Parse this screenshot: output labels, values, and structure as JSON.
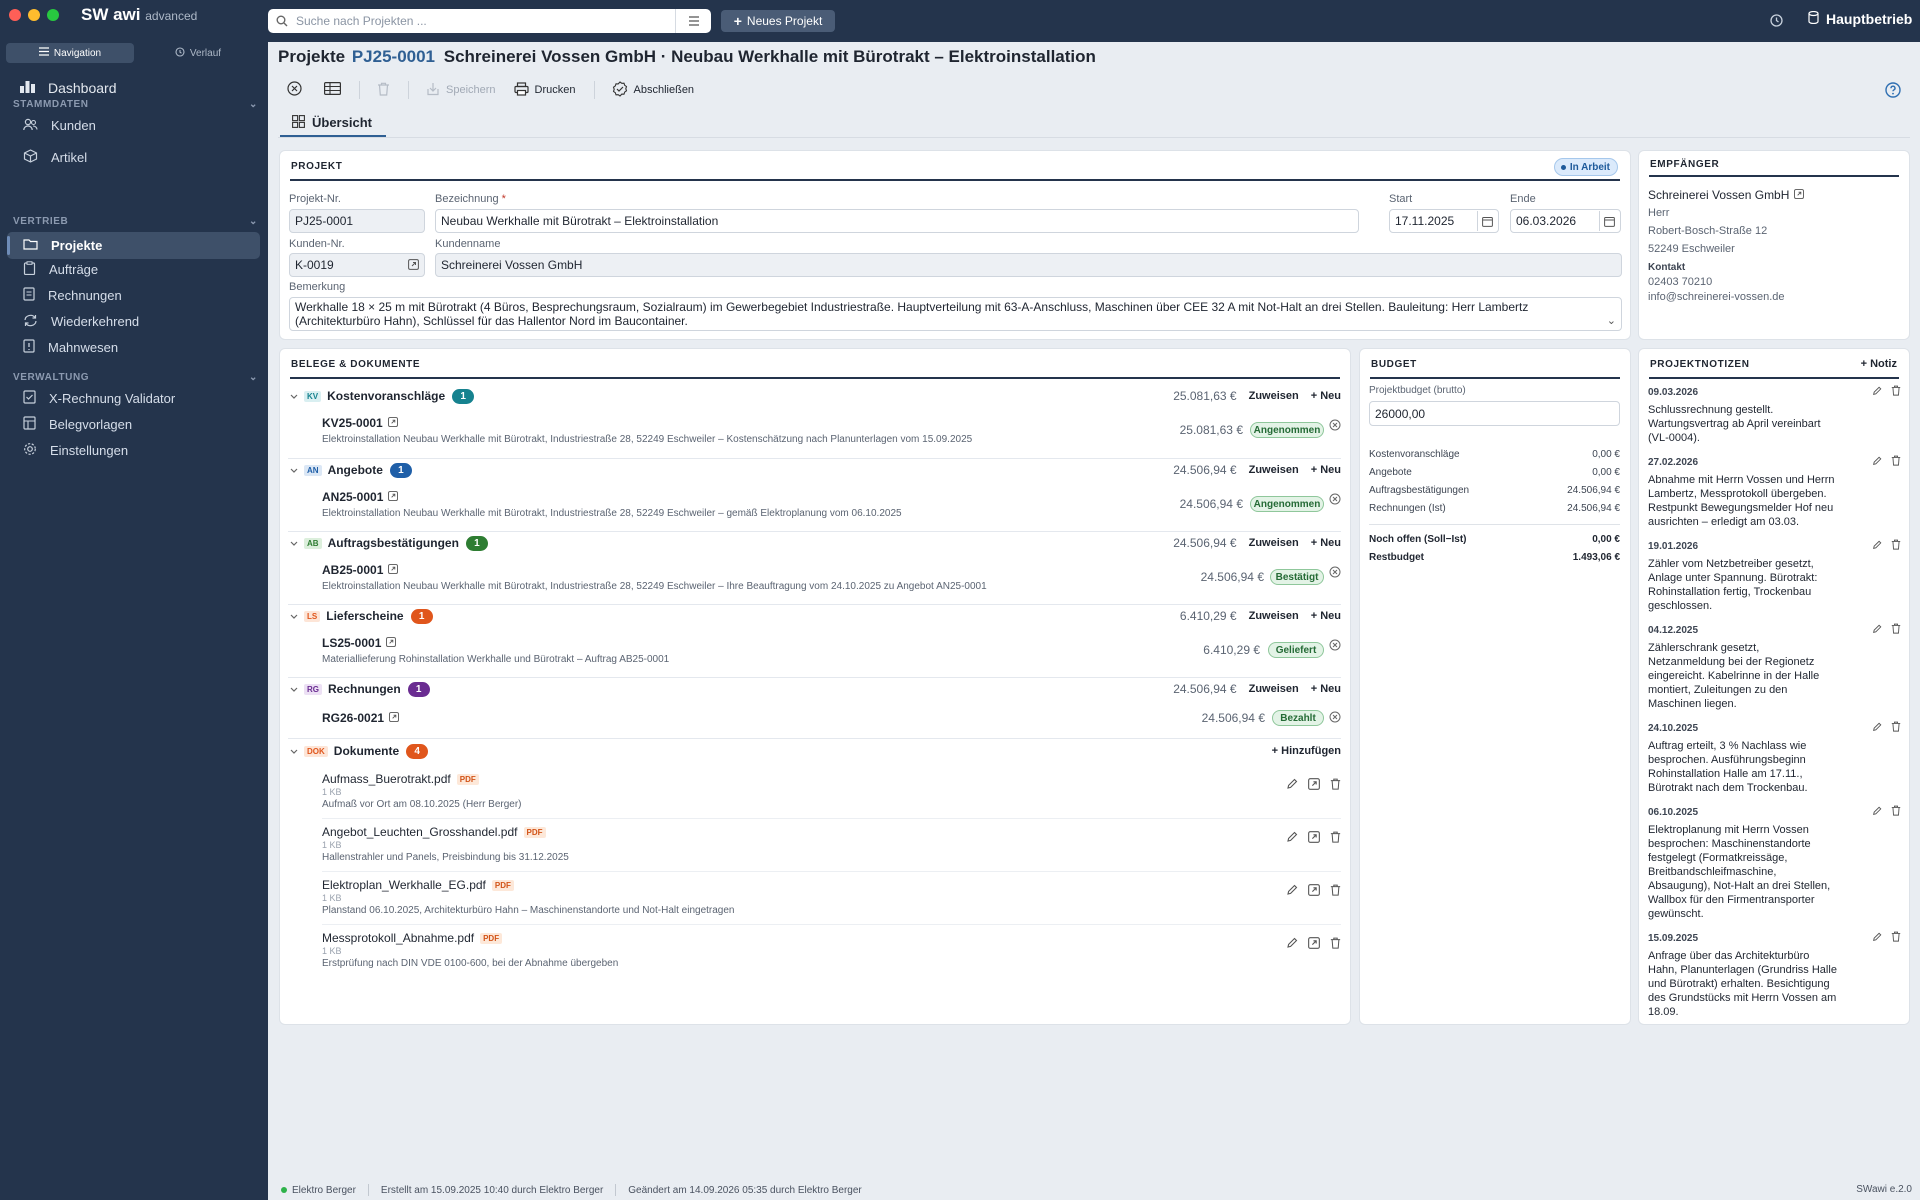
{
  "app": {
    "brand": "SW awi",
    "edition": "advanced",
    "search_placeholder": "Suche nach Projekten ...",
    "new_project": "Neues Projekt",
    "company": "Hauptbetrieb",
    "colors": {
      "navy": "#24344c",
      "accent": "#2f5f93"
    }
  },
  "sidebar": {
    "tab_nav": "Navigation",
    "tab_history": "Verlauf",
    "dashboard": "Dashboard",
    "sections": [
      {
        "title": "STAMMDATEN",
        "items": [
          {
            "label": "Kunden",
            "icon": "users-icon"
          },
          {
            "label": "Artikel",
            "icon": "box-icon"
          }
        ]
      },
      {
        "title": "VERTRIEB",
        "items": [
          {
            "label": "Projekte",
            "icon": "folder-icon",
            "active": true
          },
          {
            "label": "Aufträge",
            "icon": "clipboard-icon"
          },
          {
            "label": "Rechnungen",
            "icon": "invoice-icon"
          },
          {
            "label": "Wiederkehrend",
            "icon": "repeat-icon"
          },
          {
            "label": "Mahnwesen",
            "icon": "reminder-icon"
          }
        ]
      },
      {
        "title": "VERWALTUNG",
        "items": [
          {
            "label": "X-Rechnung Validator",
            "icon": "checklist-icon"
          },
          {
            "label": "Belegvorlagen",
            "icon": "template-icon"
          },
          {
            "label": "Einstellungen",
            "icon": "gear-icon"
          }
        ]
      }
    ]
  },
  "page": {
    "prefix": "Projekte",
    "number": "PJ25-0001",
    "title": "Schreinerei Vossen GmbH · Neubau Werkhalle mit Bürotrakt – Elektroinstallation"
  },
  "toolbar": {
    "save": "Speichern",
    "print": "Drucken",
    "close": "Abschließen"
  },
  "tabs": {
    "overview": "Übersicht"
  },
  "project": {
    "heading": "PROJEKT",
    "status": "In Arbeit",
    "nr_label": "Projekt-Nr.",
    "nr": "PJ25-0001",
    "name_label": "Bezeichnung",
    "name": "Neubau Werkhalle mit Bürotrakt – Elektroinstallation",
    "start_label": "Start",
    "start": "17.11.2025",
    "end_label": "Ende",
    "end": "06.03.2026",
    "cust_nr_label": "Kunden-Nr.",
    "cust_nr": "K-0019",
    "cust_name_label": "Kundenname",
    "cust_name": "Schreinerei Vossen GmbH",
    "remark_label": "Bemerkung",
    "remark_1": "Werkhalle 18 × 25 m mit Bürotrakt (4 Büros, Besprechungsraum, Sozialraum) im Gewerbegebiet Industriestraße. Hauptverteilung mit 63-A-Anschluss, Maschinen über CEE 32 A mit Not-Halt an drei Stellen. Bauleitung: Herr Lambertz",
    "remark_2": "(Architekturbüro Hahn), Schlüssel für das Hallentor Nord im Baucontainer."
  },
  "recipient": {
    "heading": "EMPFÄNGER",
    "name": "Schreinerei Vossen GmbH",
    "salutation": "Herr",
    "street": "Robert-Bosch-Straße 12",
    "city": "52249 Eschweiler",
    "contact_label": "Kontakt",
    "phone": "02403 70210",
    "email": "info@schreinerei-vossen.de"
  },
  "docs": {
    "heading": "BELEGE & DOKUMENTE",
    "assign": "Zuweisen",
    "new": "+ Neu",
    "groups": [
      {
        "tag": "KV",
        "name": "Kostenvoranschläge",
        "count": "1",
        "sum": "25.081,63 €",
        "color": "#16828f",
        "doc": {
          "no": "KV25-0001",
          "desc": "Elektroinstallation Neubau Werkhalle mit Bürotrakt, Industriestraße 28, 52249 Eschweiler – Kostenschätzung nach Planunterlagen vom 15.09.2025",
          "amount": "25.081,63 €",
          "status": "Angenommen"
        }
      },
      {
        "tag": "AN",
        "name": "Angebote",
        "count": "1",
        "sum": "24.506,94 €",
        "color": "#1f5fa8",
        "doc": {
          "no": "AN25-0001",
          "desc": "Elektroinstallation Neubau Werkhalle mit Bürotrakt, Industriestraße 28, 52249 Eschweiler – gemäß Elektroplanung vom 06.10.2025",
          "amount": "24.506,94 €",
          "status": "Angenommen"
        }
      },
      {
        "tag": "AB",
        "name": "Auftragsbestätigungen",
        "count": "1",
        "sum": "24.506,94 €",
        "color": "#2e7d32",
        "doc": {
          "no": "AB25-0001",
          "desc": "Elektroinstallation Neubau Werkhalle mit Bürotrakt, Industriestraße 28, 52249 Eschweiler – Ihre Beauftragung vom 24.10.2025 zu Angebot AN25-0001",
          "amount": "24.506,94 €",
          "status": "Bestätigt"
        }
      },
      {
        "tag": "LS",
        "name": "Lieferscheine",
        "count": "1",
        "sum": "6.410,29 €",
        "color": "#e0561c",
        "doc": {
          "no": "LS25-0001",
          "desc": "Materiallieferung Rohinstallation Werkhalle und Bürotrakt – Auftrag AB25-0001",
          "amount": "6.410,29 €",
          "status": "Geliefert"
        }
      },
      {
        "tag": "RG",
        "name": "Rechnungen",
        "count": "1",
        "sum": "24.506,94 €",
        "color": "#6a2c91",
        "doc": {
          "no": "RG26-0021",
          "desc": "",
          "amount": "24.506,94 €",
          "status": "Bezahlt"
        }
      }
    ],
    "files_tag": "DOK",
    "files_name": "Dokumente",
    "files_count": "4",
    "add": "+ Hinzufügen",
    "files": [
      {
        "name": "Aufmass_Buerotrakt.pdf",
        "type": "PDF",
        "size": "1 KB",
        "desc": "Aufmaß vor Ort am 08.10.2025 (Herr Berger)"
      },
      {
        "name": "Angebot_Leuchten_Grosshandel.pdf",
        "type": "PDF",
        "size": "1 KB",
        "desc": "Hallenstrahler und Panels, Preisbindung bis 31.12.2025"
      },
      {
        "name": "Elektroplan_Werkhalle_EG.pdf",
        "type": "PDF",
        "size": "1 KB",
        "desc": "Planstand 06.10.2025, Architekturbüro Hahn – Maschinenstandorte und Not-Halt eingetragen"
      },
      {
        "name": "Messprotokoll_Abnahme.pdf",
        "type": "PDF",
        "size": "1 KB",
        "desc": "Erstprüfung nach DIN VDE 0100-600, bei der Abnahme übergeben"
      }
    ]
  },
  "budget": {
    "heading": "BUDGET",
    "label": "Projektbudget (brutto)",
    "value": "26000,00",
    "rows": [
      {
        "label": "Kostenvoranschläge",
        "value": "0,00 €"
      },
      {
        "label": "Angebote",
        "value": "0,00 €"
      },
      {
        "label": "Auftragsbestätigungen",
        "value": "24.506,94 €"
      },
      {
        "label": "Rechnungen (Ist)",
        "value": "24.506,94 €"
      }
    ],
    "open_label": "Noch offen (Soll−Ist)",
    "open_value": "0,00 €",
    "rest_label": "Restbudget",
    "rest_value": "1.493,06 €"
  },
  "notes": {
    "heading": "PROJEKTNOTIZEN",
    "add": "+ Notiz",
    "items": [
      {
        "date": "09.03.2026",
        "lines": [
          "Schlussrechnung gestellt.",
          "Wartungsvertrag ab April vereinbart",
          "(VL-0004)."
        ]
      },
      {
        "date": "27.02.2026",
        "lines": [
          "Abnahme mit Herrn Vossen und Herrn",
          "Lambertz, Messprotokoll übergeben.",
          "Restpunkt Bewegungsmelder Hof neu",
          "ausrichten – erledigt am 03.03."
        ]
      },
      {
        "date": "19.01.2026",
        "lines": [
          "Zähler vom Netzbetreiber gesetzt,",
          "Anlage unter Spannung. Bürotrakt:",
          "Rohinstallation fertig, Trockenbau",
          "geschlossen."
        ]
      },
      {
        "date": "04.12.2025",
        "lines": [
          "Zählerschrank gesetzt,",
          "Netzanmeldung bei der Regionetz",
          "eingereicht. Kabelrinne in der Halle",
          "montiert, Zuleitungen zu den",
          "Maschinen liegen."
        ]
      },
      {
        "date": "24.10.2025",
        "lines": [
          "Auftrag erteilt, 3 % Nachlass wie",
          "besprochen. Ausführungsbeginn",
          "Rohinstallation Halle am 17.11.,",
          "Bürotrakt nach dem Trockenbau."
        ]
      },
      {
        "date": "06.10.2025",
        "lines": [
          "Elektroplanung mit Herrn Vossen",
          "besprochen: Maschinenstandorte",
          "festgelegt (Formatkreissäge,",
          "Breitbandschleifmaschine,",
          "Absaugung), Not-Halt an drei Stellen,",
          "Wallbox für den Firmentransporter",
          "gewünscht."
        ]
      },
      {
        "date": "15.09.2025",
        "lines": [
          "Anfrage über das Architekturbüro",
          "Hahn, Planunterlagen (Grundriss Halle",
          "und Bürotrakt) erhalten. Besichtigung",
          "des Grundstücks mit Herrn Vossen am",
          "18.09."
        ]
      }
    ]
  },
  "status": {
    "user": "Elektro Berger",
    "created": "Erstellt am 15.09.2025 10:40 durch Elektro Berger",
    "changed": "Geändert am 14.09.2026 05:35 durch Elektro Berger",
    "version": "SWawi e.2.0"
  }
}
